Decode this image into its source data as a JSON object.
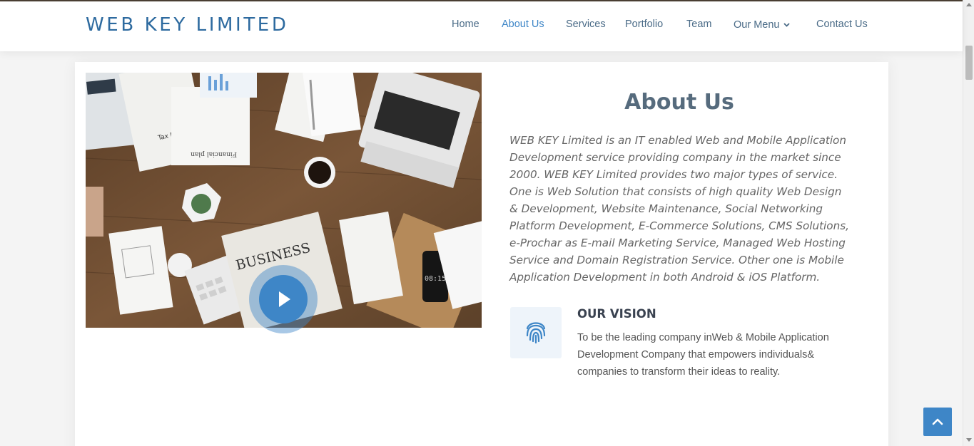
{
  "brand": "WEB KEY LIMITED",
  "nav": {
    "items": [
      {
        "label": "Home"
      },
      {
        "label": "About Us",
        "active": true
      },
      {
        "label": "Services"
      },
      {
        "label": "Portfolio"
      },
      {
        "label": "Team"
      },
      {
        "label": "Our Menu",
        "has_dropdown": true
      },
      {
        "label": "Contact Us"
      }
    ]
  },
  "about": {
    "title": "About Us",
    "body": "WEB KEY Limited is an IT enabled Web and Mobile Application Development service providing company in the market since 2000. WEB KEY Limited provides two major types of service. One is Web Solution that consists of high quality Web Design & Development, Website Maintenance, Social Networking Platform Development, E-Commerce Solutions, CMS Solutions, e-Prochar as E-mail Marketing Service, Managed Web Hosting Service and Domain Registration Service. Other one is Mobile Application Development in both Android & iOS Platform."
  },
  "video": {
    "image": "desk-workspace-photo",
    "play_icon": "play-icon",
    "image_text": {
      "tax_form": "Tax Refund Form",
      "financial_plan": "Financial plan",
      "newspaper": "BUSINESS",
      "phone_clock": "08:15"
    }
  },
  "vision": {
    "icon": "fingerprint-icon",
    "title": "OUR VISION",
    "text": "To be the leading company inWeb & Mobile Application Development Company that empowers individuals& companies to transform their ideas to reality."
  },
  "colors": {
    "accent": "#3e86c7",
    "brand": "#2d6a9f",
    "nav_text": "#4a6b87",
    "heading": "#566b7d"
  },
  "back_to_top": {
    "icon": "chevron-up-icon"
  }
}
